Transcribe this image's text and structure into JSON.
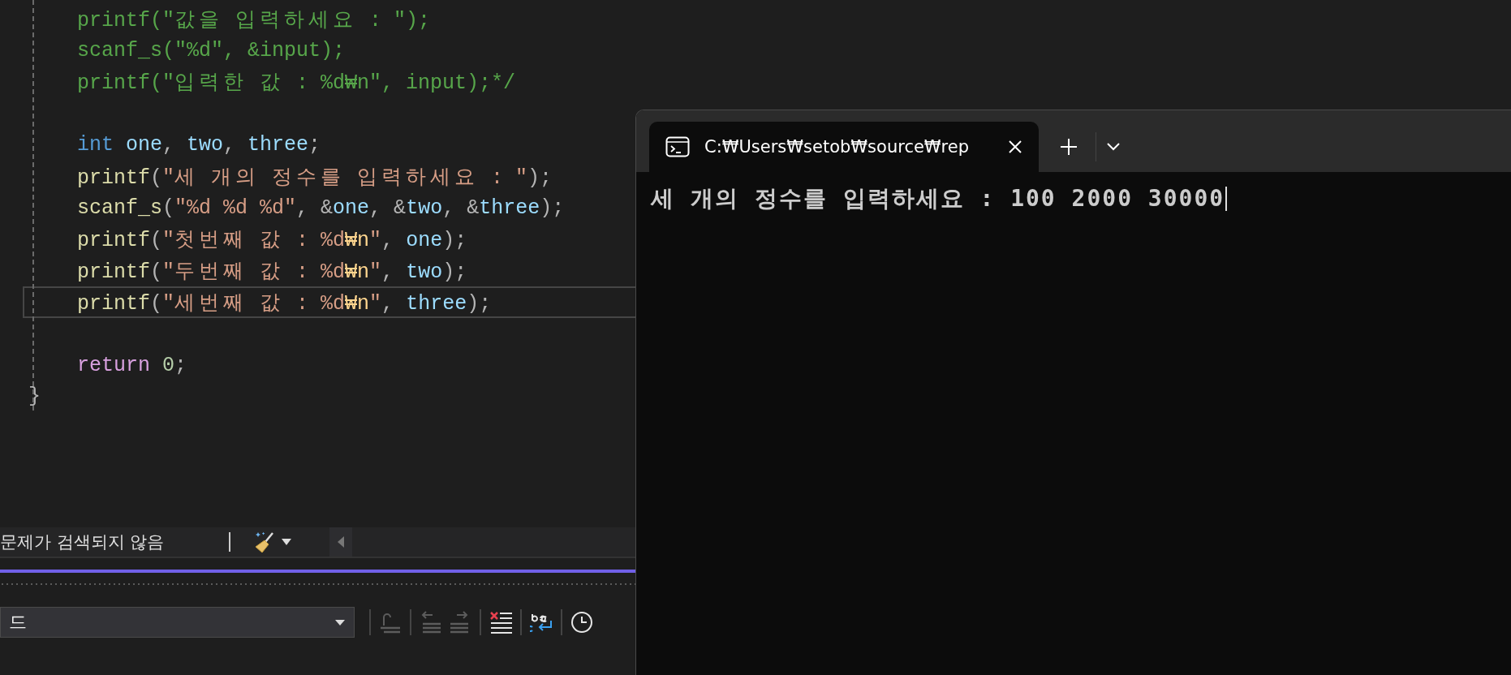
{
  "editor": {
    "lines": [
      {
        "kind": "code",
        "indented": true,
        "current": false,
        "tokens": [
          {
            "t": "printf(\"값을 입력하세요 : \");",
            "kind": "comment"
          }
        ]
      },
      {
        "kind": "code",
        "indented": true,
        "current": false,
        "tokens": [
          {
            "t": "scanf_s(\"%d\", &input);",
            "kind": "comment"
          }
        ]
      },
      {
        "kind": "code",
        "indented": true,
        "current": false,
        "tokens": [
          {
            "t": "printf(\"입력한 값 : %d₩n\", input);*/",
            "kind": "comment"
          }
        ]
      },
      {
        "kind": "blank"
      },
      {
        "kind": "code",
        "indented": true,
        "current": false,
        "tokens": [
          {
            "t": "int ",
            "kind": "kw"
          },
          {
            "t": "one",
            "kind": "var"
          },
          {
            "t": ", ",
            "kind": "punct"
          },
          {
            "t": "two",
            "kind": "var"
          },
          {
            "t": ", ",
            "kind": "punct"
          },
          {
            "t": "three",
            "kind": "var"
          },
          {
            "t": ";",
            "kind": "punct"
          }
        ]
      },
      {
        "kind": "code",
        "indented": true,
        "current": false,
        "tokens": [
          {
            "t": "printf",
            "kind": "fn"
          },
          {
            "t": "(",
            "kind": "punct"
          },
          {
            "t": "\"세 개의 정수를 입력하세요 : \"",
            "kind": "str"
          },
          {
            "t": ");",
            "kind": "punct"
          }
        ]
      },
      {
        "kind": "code",
        "indented": true,
        "current": false,
        "tokens": [
          {
            "t": "scanf_s",
            "kind": "fn"
          },
          {
            "t": "(",
            "kind": "punct"
          },
          {
            "t": "\"%d %d %d\"",
            "kind": "str"
          },
          {
            "t": ", &",
            "kind": "punct"
          },
          {
            "t": "one",
            "kind": "var"
          },
          {
            "t": ", &",
            "kind": "punct"
          },
          {
            "t": "two",
            "kind": "var"
          },
          {
            "t": ", &",
            "kind": "punct"
          },
          {
            "t": "three",
            "kind": "var"
          },
          {
            "t": ");",
            "kind": "punct"
          }
        ]
      },
      {
        "kind": "code",
        "indented": true,
        "current": false,
        "tokens": [
          {
            "t": "printf",
            "kind": "fn"
          },
          {
            "t": "(",
            "kind": "punct"
          },
          {
            "t": "\"첫번째 값 : %d",
            "kind": "str"
          },
          {
            "t": "₩n",
            "kind": "esc"
          },
          {
            "t": "\"",
            "kind": "str"
          },
          {
            "t": ", ",
            "kind": "punct"
          },
          {
            "t": "one",
            "kind": "var"
          },
          {
            "t": ");",
            "kind": "punct"
          }
        ]
      },
      {
        "kind": "code",
        "indented": true,
        "current": false,
        "tokens": [
          {
            "t": "printf",
            "kind": "fn"
          },
          {
            "t": "(",
            "kind": "punct"
          },
          {
            "t": "\"두번째 값 : %d",
            "kind": "str"
          },
          {
            "t": "₩n",
            "kind": "esc"
          },
          {
            "t": "\"",
            "kind": "str"
          },
          {
            "t": ", ",
            "kind": "punct"
          },
          {
            "t": "two",
            "kind": "var"
          },
          {
            "t": ");",
            "kind": "punct"
          }
        ]
      },
      {
        "kind": "code",
        "indented": true,
        "current": true,
        "tokens": [
          {
            "t": "printf",
            "kind": "fn"
          },
          {
            "t": "(",
            "kind": "punct"
          },
          {
            "t": "\"세번째 값 : %d",
            "kind": "str"
          },
          {
            "t": "₩n",
            "kind": "esc"
          },
          {
            "t": "\"",
            "kind": "str"
          },
          {
            "t": ", ",
            "kind": "punct"
          },
          {
            "t": "three",
            "kind": "var"
          },
          {
            "t": ");",
            "kind": "punct"
          }
        ]
      },
      {
        "kind": "blank"
      },
      {
        "kind": "code",
        "indented": true,
        "current": false,
        "tokens": [
          {
            "t": "return ",
            "kind": "ctrl"
          },
          {
            "t": "0",
            "kind": "num"
          },
          {
            "t": ";",
            "kind": "punct"
          }
        ]
      },
      {
        "kind": "code",
        "indented": false,
        "current": false,
        "tokens": [
          {
            "t": "}",
            "kind": "punct"
          }
        ]
      }
    ]
  },
  "status_bar": {
    "message": "문제가 검색되지 않음"
  },
  "output_panel": {
    "source_dropdown": {
      "value": "드"
    },
    "toolbar": [
      {
        "kind": "goto",
        "disabled": true
      },
      {
        "kind": "prev",
        "disabled": true
      },
      {
        "kind": "next",
        "disabled": true
      },
      {
        "kind": "clear",
        "disabled": false
      },
      {
        "kind": "wrap",
        "disabled": false
      },
      {
        "kind": "clock",
        "disabled": false
      }
    ]
  },
  "terminal": {
    "tab": {
      "title": "C:₩Users₩setob₩source₩rep",
      "selected": true
    },
    "output": "세 개의 정수를 입력하세요 : 100 2000 30000"
  }
}
